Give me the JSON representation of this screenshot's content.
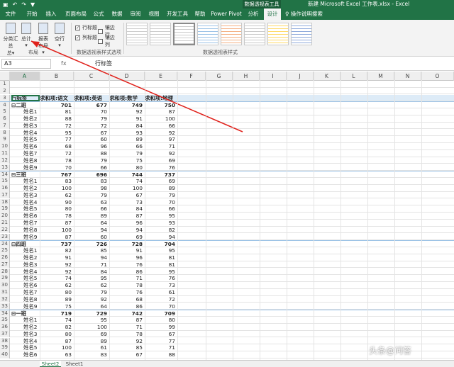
{
  "titlebar": {
    "context_tools": "数据透视表工具",
    "document_title": "新建 Microsoft Excel 工作表.xlsx  -  Excel",
    "qat_icons": [
      "save-icon",
      "undo-icon",
      "redo-icon",
      "filter-icon"
    ]
  },
  "tabs": [
    "文件",
    "开始",
    "插入",
    "页面布局",
    "公式",
    "数据",
    "审阅",
    "视图",
    "开发工具",
    "帮助",
    "Power Pivot",
    "分析",
    "设计"
  ],
  "active_tab": "设计",
  "tell_me": "操作说明搜索",
  "ribbon": {
    "buttons": [
      {
        "label": "分类汇总",
        "sub": "总▾"
      },
      {
        "label": "总计",
        "sub": "▾"
      },
      {
        "label": "报表布局",
        "sub": "▾"
      },
      {
        "label": "空行",
        "sub": "▾"
      }
    ],
    "layout_group": "布局",
    "options": [
      {
        "label": "行标题",
        "checked": true
      },
      {
        "label": "镶边行",
        "checked": false
      },
      {
        "label": "列标题",
        "checked": true
      },
      {
        "label": "镶边列",
        "checked": false
      }
    ],
    "options_group": "数据透视表样式选项",
    "styles_group": "数据透视表样式"
  },
  "formula_bar": {
    "name_box": "A3",
    "fx": "fx",
    "value": "行标签"
  },
  "columns": [
    "A",
    "B",
    "C",
    "D",
    "E",
    "F",
    "G",
    "H",
    "I",
    "J",
    "K",
    "L",
    "M",
    "N",
    "O"
  ],
  "header_row": {
    "label": "行标签",
    "v1": "求和项:语文",
    "v2": "求和项:英语",
    "v3": "求和项:数学",
    "v4": "求和项:地理"
  },
  "groups": [
    {
      "name": "二班",
      "totals": [
        "701",
        "677",
        "749",
        "750"
      ],
      "rows": [
        [
          "姓名1",
          "81",
          "70",
          "92",
          "87"
        ],
        [
          "姓名2",
          "88",
          "79",
          "91",
          "100"
        ],
        [
          "姓名3",
          "72",
          "72",
          "84",
          "66"
        ],
        [
          "姓名4",
          "95",
          "67",
          "93",
          "92"
        ],
        [
          "姓名5",
          "77",
          "60",
          "89",
          "97"
        ],
        [
          "姓名6",
          "68",
          "96",
          "66",
          "71"
        ],
        [
          "姓名7",
          "72",
          "88",
          "79",
          "92"
        ],
        [
          "姓名8",
          "78",
          "79",
          "75",
          "69"
        ],
        [
          "姓名9",
          "70",
          "66",
          "80",
          "76"
        ]
      ]
    },
    {
      "name": "三班",
      "totals": [
        "767",
        "696",
        "744",
        "737"
      ],
      "rows": [
        [
          "姓名1",
          "83",
          "83",
          "74",
          "69"
        ],
        [
          "姓名2",
          "100",
          "98",
          "100",
          "89"
        ],
        [
          "姓名3",
          "62",
          "79",
          "67",
          "79"
        ],
        [
          "姓名4",
          "90",
          "63",
          "73",
          "70"
        ],
        [
          "姓名5",
          "80",
          "66",
          "84",
          "66"
        ],
        [
          "姓名6",
          "78",
          "89",
          "87",
          "95"
        ],
        [
          "姓名7",
          "87",
          "64",
          "96",
          "93"
        ],
        [
          "姓名8",
          "100",
          "94",
          "94",
          "82"
        ],
        [
          "姓名9",
          "87",
          "60",
          "69",
          "94"
        ]
      ]
    },
    {
      "name": "四班",
      "totals": [
        "737",
        "726",
        "728",
        "704"
      ],
      "rows": [
        [
          "姓名1",
          "82",
          "85",
          "91",
          "95"
        ],
        [
          "姓名2",
          "91",
          "94",
          "96",
          "81"
        ],
        [
          "姓名3",
          "92",
          "71",
          "76",
          "81"
        ],
        [
          "姓名4",
          "92",
          "84",
          "86",
          "95"
        ],
        [
          "姓名5",
          "74",
          "95",
          "71",
          "76"
        ],
        [
          "姓名6",
          "62",
          "62",
          "78",
          "73"
        ],
        [
          "姓名7",
          "80",
          "79",
          "76",
          "61"
        ],
        [
          "姓名8",
          "89",
          "92",
          "68",
          "72"
        ],
        [
          "姓名9",
          "75",
          "64",
          "86",
          "70"
        ]
      ]
    },
    {
      "name": "一班",
      "totals": [
        "719",
        "729",
        "742",
        "709"
      ],
      "rows": [
        [
          "姓名1",
          "74",
          "95",
          "87",
          "80"
        ],
        [
          "姓名2",
          "82",
          "100",
          "71",
          "99"
        ],
        [
          "姓名3",
          "80",
          "69",
          "78",
          "67"
        ],
        [
          "姓名4",
          "87",
          "89",
          "92",
          "77"
        ],
        [
          "姓名5",
          "100",
          "61",
          "85",
          "71"
        ],
        [
          "姓名6",
          "63",
          "83",
          "67",
          "88"
        ]
      ]
    }
  ],
  "sheets": [
    "Sheet2",
    "Sheet1"
  ],
  "active_sheet": "Sheet2",
  "watermark": "头条@问答"
}
